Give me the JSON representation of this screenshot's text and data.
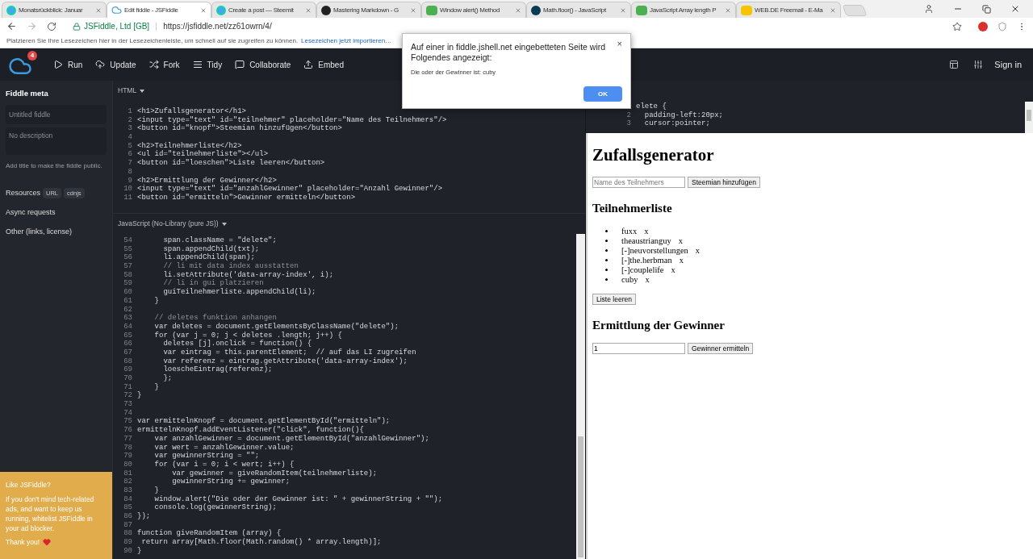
{
  "browser": {
    "tabs": [
      {
        "title": "Monatsrückblick: Januar",
        "selected": false
      },
      {
        "title": "Edit fiddle - JSFiddle",
        "selected": true
      },
      {
        "title": "Create a post — Steemit",
        "selected": false
      },
      {
        "title": "Mastering Markdown - G",
        "selected": false
      },
      {
        "title": "Window alert() Method",
        "selected": false
      },
      {
        "title": "Math.floor() - JavaScript",
        "selected": false
      },
      {
        "title": "JavaScript Array length P",
        "selected": false
      },
      {
        "title": "WEB.DE Freemail - E-Ma",
        "selected": false
      }
    ],
    "address": {
      "site_name": "JSFiddle, Ltd [GB]",
      "url": "https://jsfiddle.net/zz61owrn/4/"
    },
    "bookmarks_bar": {
      "message": "Platzieren Sie Ihre Lesezeichen hier in der Lesezeichenleiste, um schnell auf sie zugreifen zu können.",
      "link": "Lesezeichen jetzt importieren…"
    }
  },
  "toolbar": {
    "notification_count": "4",
    "actions": [
      {
        "label": "Run"
      },
      {
        "label": "Update"
      },
      {
        "label": "Fork"
      },
      {
        "label": "Tidy"
      },
      {
        "label": "Collaborate"
      },
      {
        "label": "Embed"
      }
    ],
    "sign_in": "Sign in"
  },
  "sidebar": {
    "title": "Fiddle meta",
    "title_field": {
      "placeholder": "Untitled fiddle"
    },
    "description_field": {
      "placeholder": "No description"
    },
    "hint": "Add title to make the fiddle public.",
    "sections": [
      {
        "label": "Resources",
        "badges": [
          "URL",
          "cdnjs"
        ]
      },
      {
        "label": "Async requests"
      },
      {
        "label": "Other (links, license)"
      }
    ],
    "promo": {
      "title": "Like JSFiddle?",
      "text": "If you don't mind tech-related ads, and want to keep us running, whitelist JSFiddle in your ad blocker.",
      "thanks": "Thank you!"
    }
  },
  "html_panel": {
    "label": "HTML",
    "lines": [
      {
        "n": "1",
        "code": "<h1>Zufallsgenerator</h1>"
      },
      {
        "n": "2",
        "code": "<input type=\"text\" id=\"teilnehmer\" placeholder=\"Name des Teilnehmers\"/>"
      },
      {
        "n": "3",
        "code": "<button id=\"knopf\">Steemian hinzufügen</button>"
      },
      {
        "n": "4"
      },
      {
        "n": "5",
        "code": "<h2>Teilnehmerliste</h2>"
      },
      {
        "n": "6",
        "code": "<ul id=\"teilnehmerliste\"></ul>"
      },
      {
        "n": "7",
        "code": "<button id=\"loeschen\">Liste leeren</button>"
      },
      {
        "n": "8"
      },
      {
        "n": "9",
        "code": "<h2>Ermittlung der Gewinner</h2>"
      },
      {
        "n": "10",
        "code": "<input type=\"text\" id=\"anzahlGewinner\" placeholder=\"Anzahl Gewinner\"/>"
      },
      {
        "n": "11",
        "code": "<button id=\"ermitteln\">Gewinner ermitteln</button>"
      }
    ]
  },
  "js_panel": {
    "label": "JavaScript (No-Library (pure JS))",
    "lines": [
      {
        "n": "54",
        "code": "      span.className = \"delete\";"
      },
      {
        "n": "55",
        "code": "      span.appendChild(txt);"
      },
      {
        "n": "56",
        "code": "      li.appendChild(span);"
      },
      {
        "n": "57",
        "code": "      // li mit data index ausstatten",
        "kind": "comment"
      },
      {
        "n": "58",
        "code": "      li.setAttribute('data-array-index', i);"
      },
      {
        "n": "59",
        "code": "      // li in gui platzieren",
        "kind": "comment"
      },
      {
        "n": "60",
        "code": "      guiTeilnehmerliste.appendChild(li);"
      },
      {
        "n": "61",
        "code": "    }"
      },
      {
        "n": "62"
      },
      {
        "n": "63",
        "code": "    // deletes funktion anhangen",
        "kind": "comment"
      },
      {
        "n": "64",
        "code": "    var deletes = document.getElementsByClassName(\"delete\");"
      },
      {
        "n": "65",
        "code": "    for (var j = 0; j < deletes .length; j++) {"
      },
      {
        "n": "66",
        "code": "      deletes [j].onclick = function() {"
      },
      {
        "n": "67",
        "code": "      var eintrag = this.parentElement;  // auf das LI zugreifen"
      },
      {
        "n": "68",
        "code": "      var referenz = eintrag.getAttribute('data-array-index');"
      },
      {
        "n": "69",
        "code": "      loescheEintrag(referenz);"
      },
      {
        "n": "70",
        "code": "      };"
      },
      {
        "n": "71",
        "code": "    }"
      },
      {
        "n": "72",
        "code": "}"
      },
      {
        "n": "73"
      },
      {
        "n": "74"
      },
      {
        "n": "75",
        "code": "var ermittelnKnopf = document.getElementById(\"ermitteln\");"
      },
      {
        "n": "76",
        "code": "ermittelnKnopf.addEventListener(\"click\", function(){"
      },
      {
        "n": "77",
        "code": "    var anzahlGewinner = document.getElementById(\"anzahlGewinner\");"
      },
      {
        "n": "78",
        "code": "    var wert = anzahlGewinner.value;"
      },
      {
        "n": "79",
        "code": "    var gewinnerString = \"\";"
      },
      {
        "n": "80",
        "code": "    for (var i = 0; i < wert; i++) {"
      },
      {
        "n": "81",
        "code": "        var gewinner = giveRandomItem(teilnehmerliste);"
      },
      {
        "n": "82",
        "code": "        gewinnerString += gewinner;"
      },
      {
        "n": "83",
        "code": "    }"
      },
      {
        "n": "84",
        "code": "    window.alert(\"Die oder der Gewinner ist: \" + gewinnerString + \"\");"
      },
      {
        "n": "85",
        "code": "    console.log(gewinnerString);"
      },
      {
        "n": "86",
        "code": "});"
      },
      {
        "n": "87"
      },
      {
        "n": "88",
        "code": "function giveRandomItem (array) {"
      },
      {
        "n": "89",
        "code": " return array[Math.floor(Math.random() * array.length)];"
      },
      {
        "n": "90",
        "code": "}"
      }
    ]
  },
  "css_panel": {
    "lines": [
      {
        "code": "elete {"
      },
      {
        "n": "2",
        "code": "  padding-left:20px;"
      },
      {
        "n": "3",
        "code": "  cursor:pointer;"
      }
    ]
  },
  "result": {
    "heading": "Zufallsgenerator",
    "name_field": {
      "placeholder": "Name des Teilnehmers"
    },
    "add_button": "Steemian hinzufügen",
    "list_heading": "Teilnehmerliste",
    "participants": [
      {
        "name": "fuxx",
        "remove": "x"
      },
      {
        "name": "theaustrianguy",
        "remove": "x"
      },
      {
        "name": "[-]neuvorstellungen",
        "remove": "x"
      },
      {
        "name": "[-]the.herbman",
        "remove": "x"
      },
      {
        "name": "[-]couplelife",
        "remove": "x"
      },
      {
        "name": "cuby",
        "remove": "x"
      }
    ],
    "clear_button": "Liste leeren",
    "winner_heading": "Ermittlung der Gewinner",
    "count_field": {
      "value": "1"
    },
    "winner_button": "Gewinner ermitteln"
  },
  "dialog": {
    "title": "Auf einer in fiddle.jshell.net eingebetteten Seite wird Folgendes angezeigt:",
    "message": "Die oder der Gewinner ist: cuby",
    "ok": "OK",
    "close": "×"
  }
}
